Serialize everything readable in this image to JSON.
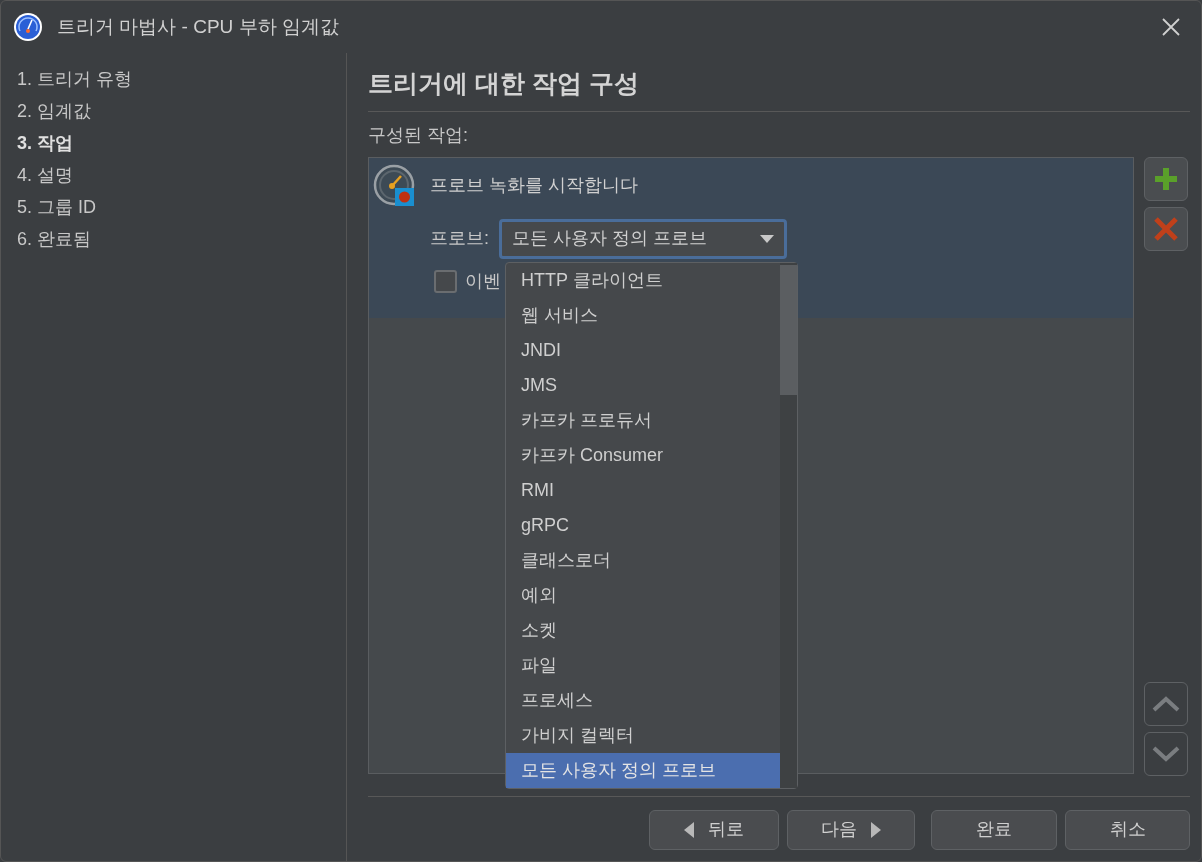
{
  "window": {
    "title": "트리거 마법사 - CPU 부하 임계값"
  },
  "steps": [
    {
      "label": "1. 트리거 유형",
      "selected": false
    },
    {
      "label": "2. 임계값",
      "selected": false
    },
    {
      "label": "3. 작업",
      "selected": true
    },
    {
      "label": "4. 설명",
      "selected": false
    },
    {
      "label": "5. 그룹 ID",
      "selected": false
    },
    {
      "label": "6. 완료됨",
      "selected": false
    }
  ],
  "heading": "트리거에 대한 작업 구성",
  "actions_label": "구성된 작업:",
  "actions": [
    {
      "title": "프로브 녹화를 시작합니다",
      "selected": true,
      "probe_label": "프로브:",
      "probe_value": "모든 사용자 정의 프로브",
      "event_checkbox": {
        "label": "이벤",
        "checked": false
      }
    }
  ],
  "dropdown": {
    "items": [
      {
        "label": "HTTP 클라이언트",
        "selected": false
      },
      {
        "label": "웹 서비스",
        "selected": false
      },
      {
        "label": "JNDI",
        "selected": false
      },
      {
        "label": "JMS",
        "selected": false
      },
      {
        "label": "카프카 프로듀서",
        "selected": false
      },
      {
        "label": "카프카 Consumer",
        "selected": false
      },
      {
        "label": "RMI",
        "selected": false
      },
      {
        "label": "gRPC",
        "selected": false
      },
      {
        "label": "클래스로더",
        "selected": false
      },
      {
        "label": "예외",
        "selected": false
      },
      {
        "label": "소켓",
        "selected": false
      },
      {
        "label": "파일",
        "selected": false
      },
      {
        "label": "프로세스",
        "selected": false
      },
      {
        "label": "가비지 컬렉터",
        "selected": false
      },
      {
        "label": "모든 사용자 정의 프로브",
        "selected": true
      }
    ]
  },
  "buttons": [
    {
      "label": "뒤로",
      "kind": "back"
    },
    {
      "label": "다음",
      "kind": "next"
    },
    {
      "label": "완료",
      "kind": "plain"
    },
    {
      "label": "취소",
      "kind": "plain"
    }
  ]
}
